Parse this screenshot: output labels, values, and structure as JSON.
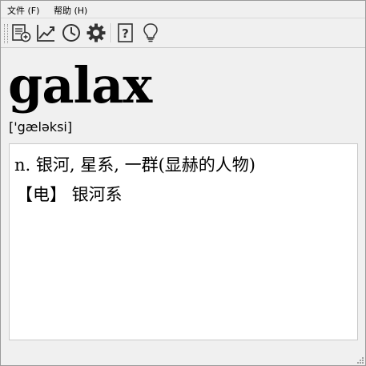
{
  "menu": {
    "file_label": "文件 (F)",
    "help_label": "帮助 (H)"
  },
  "toolbar": {
    "icons": [
      "document-add-icon",
      "chart-trend-icon",
      "clock-icon",
      "gear-icon",
      "help-icon",
      "lightbulb-icon"
    ]
  },
  "entry": {
    "word": "galax",
    "phonetic": "['gæləksi]",
    "definitions": [
      "n. 银河, 星系, 一群(显赫的人物)",
      "【电】 银河系"
    ]
  },
  "colors": {
    "window_bg": "#f0f0f0",
    "content_bg": "#ffffff",
    "icon": "#333333"
  }
}
